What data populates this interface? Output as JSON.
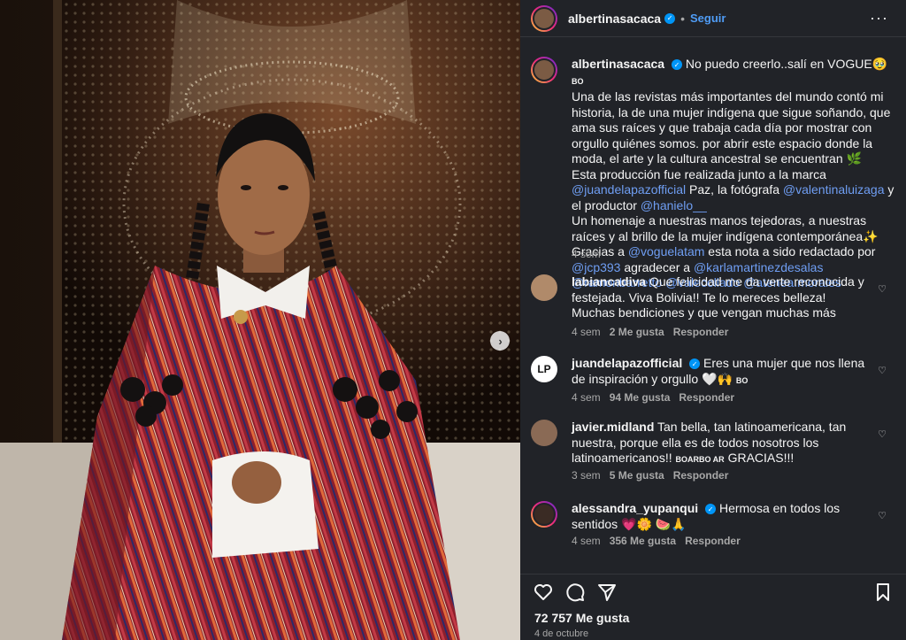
{
  "header": {
    "username": "albertinasacaca",
    "follow_label": "Seguir",
    "more_icon": "more-icon"
  },
  "caption": {
    "username": "albertinasacaca",
    "text_1": "No puedo creerlo..salí en VOGUE🥹",
    "flag_1": "BO",
    "text_2": "Una de las revistas más importantes del mundo contó mi historia, la de una mujer indígena que sigue soñando, que ama sus raíces y que trabaja cada día por mostrar con orgullo quiénes somos. por abrir este espacio donde la moda, el arte y la cultura ancestral se encuentran 🌿",
    "text_3": "Esta producción fue realizada junto a la marca",
    "mention_1": "@juandelapazofficial",
    "text_4": "Paz, la fotógrafa",
    "mention_2": "@valentinaluizaga",
    "text_5": "y el productor",
    "mention_3": "@hanielo__",
    "text_6": "Un homenaje a nuestras manos tejedoras, a nuestras raíces y al brillo de la mujer indígena contemporánea✨",
    "text_7": "Gracias a",
    "mention_4": "@voguelatam",
    "text_8": "esta nota a sido redactado por",
    "mention_5": "@jcp393",
    "text_9": "agradecer a",
    "mention_6": "@karlamartinezdesalas",
    "mention_7": "@ramonbarretto",
    "mention_8": "@valecollado",
    "mention_9": "@atenea.morales",
    "time": "4 sem"
  },
  "comments": [
    {
      "username": "labiancadiva",
      "text": "Que felicidad me da verte reconocida y festejada. Viva Bolivia!! Te lo mereces belleza! Muchas bendiciones y que vengan muchas más",
      "time": "4 sem",
      "likes": "2 Me gusta",
      "reply": "Responder"
    },
    {
      "username": "juandelapazofficial",
      "text": "Eres una mujer que nos llena de inspiración y orgullo 🤍🙌",
      "flag": "BO",
      "time": "4 sem",
      "likes": "94 Me gusta",
      "reply": "Responder"
    },
    {
      "username": "javier.midland",
      "text": "Tan bella, tan latinoamericana, tan nuestra, porque ella es de todos nosotros los latinoamericanos!!",
      "flag": "BOARBO AR",
      "text_end": "GRACIAS!!!",
      "time": "3 sem",
      "likes": "5 Me gusta",
      "reply": "Responder"
    },
    {
      "username": "alessandra_yupanqui",
      "text": "Hermosa en todos los sentidos 💗🌼 🍉🙏",
      "time": "4 sem",
      "likes": "356 Me gusta",
      "reply": "Responder"
    }
  ],
  "footer": {
    "likes": "72 757 Me gusta",
    "date": "4 de octubre"
  },
  "colors": {
    "panel_bg": "#212328",
    "accent_blue": "#0095f6",
    "mention": "#6f9ef3",
    "muted": "#a8a8a8"
  },
  "icons": [
    "heart-icon",
    "comment-icon",
    "share-icon",
    "bookmark-icon",
    "verified-icon",
    "chevron-right-icon"
  ]
}
